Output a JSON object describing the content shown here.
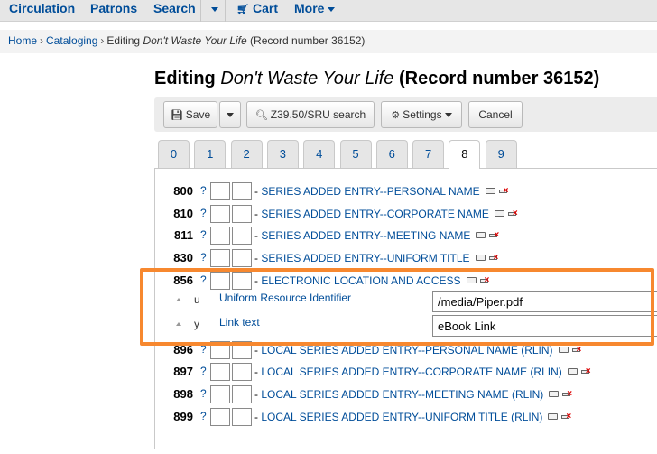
{
  "nav": {
    "circulation": "Circulation",
    "patrons": "Patrons",
    "search": "Search",
    "cart": "Cart",
    "more": "More"
  },
  "breadcrumb": {
    "home": "Home",
    "cataloging": "Cataloging",
    "current_prefix": "Editing",
    "current_title": "Don't Waste Your Life",
    "current_suffix": "(Record number 36152)",
    "separator": "›"
  },
  "title": {
    "prefix": "Editing",
    "book": "Don't Waste Your Life",
    "suffix": "(Record number 36152)"
  },
  "toolbar": {
    "save": "Save",
    "z3950": "Z39.50/SRU search",
    "settings": "Settings",
    "cancel": "Cancel"
  },
  "tabs": [
    "0",
    "1",
    "2",
    "3",
    "4",
    "5",
    "6",
    "7",
    "8",
    "9"
  ],
  "active_tab": "8",
  "fields": [
    {
      "tag": "800",
      "q": "?",
      "name": "SERIES ADDED ENTRY--PERSONAL NAME"
    },
    {
      "tag": "810",
      "q": "?",
      "name": "SERIES ADDED ENTRY--CORPORATE NAME"
    },
    {
      "tag": "811",
      "q": "?",
      "name": "SERIES ADDED ENTRY--MEETING NAME"
    },
    {
      "tag": "830",
      "q": "?",
      "name": "SERIES ADDED ENTRY--UNIFORM TITLE"
    },
    {
      "tag": "856",
      "q": "?",
      "name": "ELECTRONIC LOCATION AND ACCESS"
    },
    {
      "tag": "896",
      "q": "?",
      "name": "LOCAL SERIES ADDED ENTRY--PERSONAL NAME (RLIN)"
    },
    {
      "tag": "897",
      "q": "?",
      "name": "LOCAL SERIES ADDED ENTRY--CORPORATE NAME (RLIN)"
    },
    {
      "tag": "898",
      "q": "?",
      "name": "LOCAL SERIES ADDED ENTRY--MEETING NAME (RLIN)"
    },
    {
      "tag": "899",
      "q": "?",
      "name": "LOCAL SERIES ADDED ENTRY--UNIFORM TITLE (RLIN)"
    }
  ],
  "field_dash": "- ",
  "subfields": [
    {
      "code": "u",
      "label": "Uniform Resource Identifier",
      "value": "/media/Piper.pdf"
    },
    {
      "code": "y",
      "label": "Link text",
      "value": "eBook Link"
    }
  ],
  "colors": {
    "link": "#004d99",
    "highlight": "#f7882f",
    "delete_icon": "#dd0000"
  },
  "icons": {
    "save": "save-icon",
    "search": "search-icon",
    "settings": "gear-icon",
    "cart": "cart-icon"
  }
}
